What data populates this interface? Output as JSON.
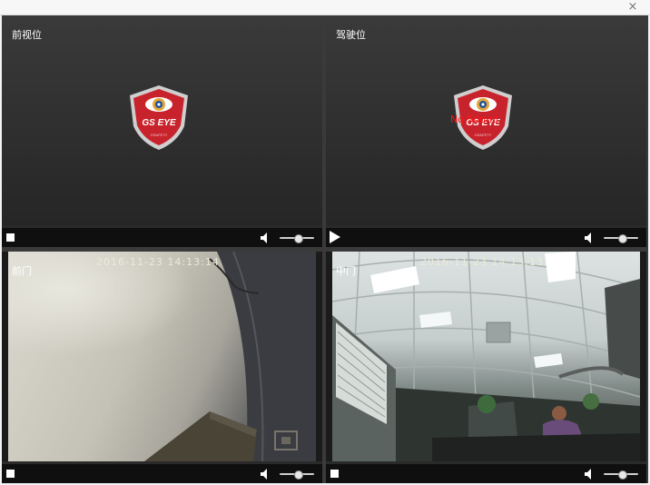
{
  "window": {
    "close_glyph": "×"
  },
  "panels": [
    {
      "label": "前视位",
      "state": "no-video",
      "logo_text": "GS EYE",
      "logo_subtext": "GSAFETY",
      "control": "stop"
    },
    {
      "label": "驾驶位",
      "state": "no-video",
      "logo_text": "GS EYE",
      "logo_subtext": "GSAFETY",
      "overlay_text": "No Sound",
      "control": "play"
    },
    {
      "label": "前门",
      "state": "live",
      "timestamp": "2016-11-23  14:13:14",
      "control": "stop"
    },
    {
      "label": "中门",
      "state": "live",
      "timestamp": "2016-11-23  14:13:13",
      "control": "stop"
    }
  ],
  "icons": {
    "stop": "stop-icon",
    "play": "play-icon",
    "volume": "speaker-icon",
    "close": "close-icon",
    "logo": "gs-eye-shield-logo"
  },
  "colors": {
    "panel_background": "#2a2a2a",
    "control_bar": "#0f0f0f",
    "logo_red": "#c8232c",
    "overlay_red": "#ff1414",
    "timestamp": "#ece9d8"
  }
}
